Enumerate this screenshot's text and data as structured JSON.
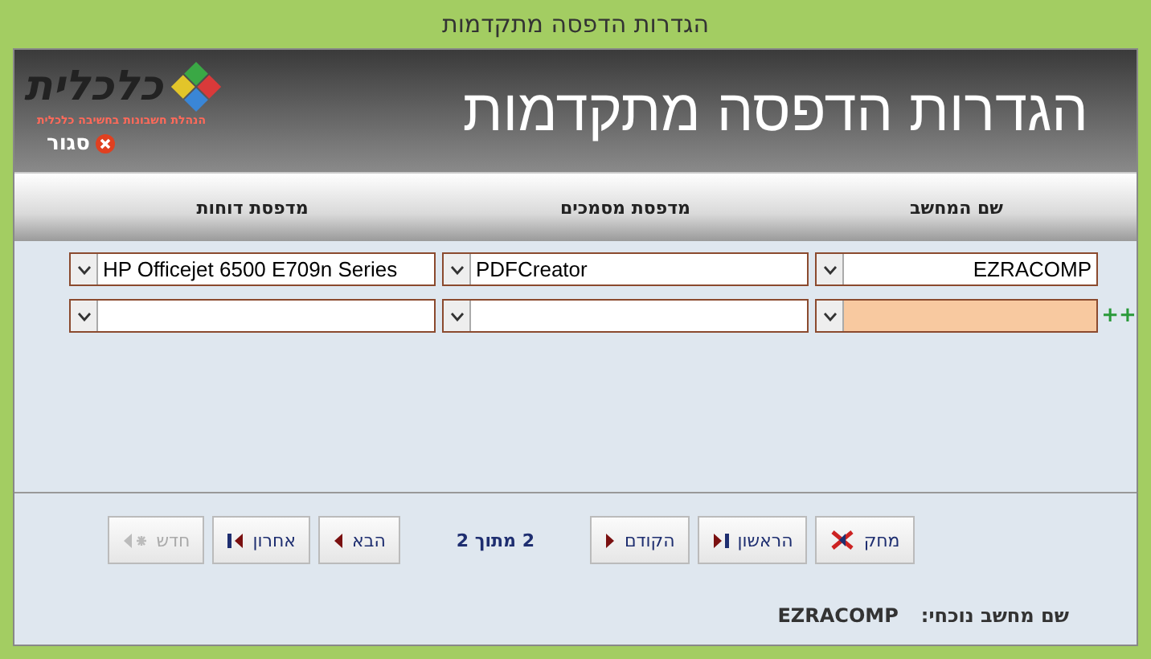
{
  "window": {
    "title": "הגדרות הדפסה מתקדמות"
  },
  "header": {
    "title": "הגדרות הדפסה מתקדמות",
    "logo_text": "כלכלית",
    "logo_tagline": "הנהלת חשבונות בחשיבה כלכלית",
    "close_label": "סגור"
  },
  "table": {
    "columns": [
      "שם המחשב",
      "מדפסת מסמכים",
      "מדפסת דוחות"
    ],
    "rows": [
      {
        "cells": [
          "EZRACOMP",
          "PDFCreator",
          "HP Officejet 6500 E709n Series"
        ],
        "focused": false
      },
      {
        "cells": [],
        "focused": true,
        "marker": "++"
      }
    ]
  },
  "navigation": {
    "buttons": [
      {
        "label": "מחק",
        "kind": "delete",
        "disabled": false
      },
      {
        "label": "הראשון",
        "kind": "first",
        "disabled": false
      },
      {
        "label": "הקודם",
        "kind": "prev",
        "disabled": false
      },
      {
        "label": "2 מתוך 2",
        "kind": "page"
      },
      {
        "label": "הבא",
        "kind": "next",
        "disabled": false
      },
      {
        "label": "אחרון",
        "kind": "last",
        "disabled": false
      },
      {
        "label": "חדש",
        "kind": "new",
        "disabled": true
      }
    ]
  },
  "status": {
    "label": "שם מחשב נוכחי:",
    "value": "EZRACOMP"
  }
}
